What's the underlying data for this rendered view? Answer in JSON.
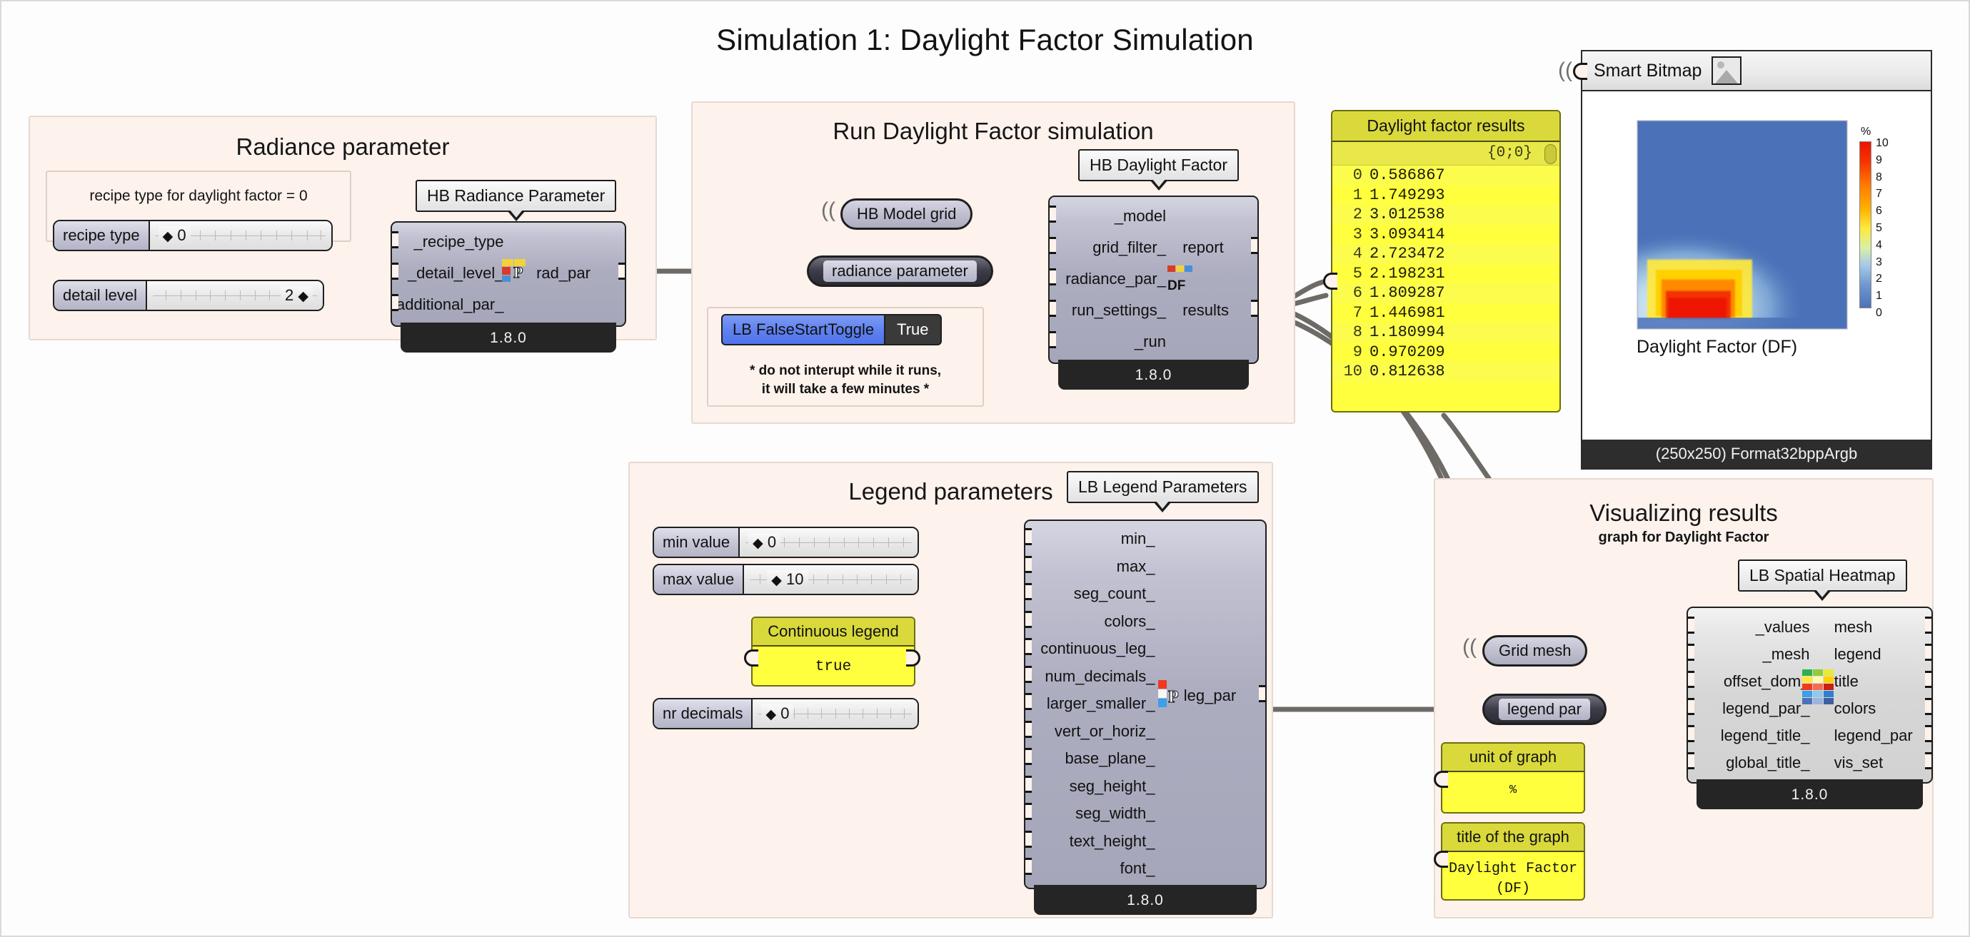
{
  "page": {
    "title": "Simulation 1: Daylight Factor Simulation"
  },
  "groups": {
    "radiance": {
      "title": "Radiance parameter",
      "note": "recipe type for daylight factor = 0",
      "sliders": [
        {
          "name": "recipe type",
          "value": "0",
          "handle": "left"
        },
        {
          "name": "detail level",
          "value": "2",
          "handle": "right"
        }
      ],
      "component": {
        "bubble": "HB Radiance Parameter",
        "inputs": [
          "_recipe_type",
          "_detail_level_",
          "additional_par_"
        ],
        "outputs": [
          "rad_par"
        ],
        "version": "1.8.0"
      }
    },
    "run_sim": {
      "title": "Run Daylight Factor simulation",
      "params": [
        {
          "label": "HB Model grid",
          "style": "light"
        },
        {
          "label": "radiance parameter",
          "style": "dark"
        }
      ],
      "toggle": {
        "name": "LB FalseStartToggle",
        "value": "True"
      },
      "note_line1": "* do not interupt while it runs,",
      "note_line2": "it will take a few minutes *",
      "component": {
        "bubble": "HB Daylight Factor",
        "inputs": [
          "_model",
          "grid_filter_",
          "radiance_par_",
          "run_settings_",
          "_run"
        ],
        "outputs": [
          "report",
          "results"
        ],
        "version": "1.8.0"
      }
    },
    "legend": {
      "title": "Legend parameters",
      "sliders": [
        {
          "name": "min value",
          "value": "0",
          "handle": "left"
        },
        {
          "name": "max value",
          "value": "10",
          "handle": "left"
        },
        {
          "name": "nr decimals",
          "value": "0",
          "handle": "left"
        }
      ],
      "panel": {
        "head": "Continuous legend",
        "body": "true"
      },
      "component": {
        "bubble": "LB Legend Parameters",
        "inputs": [
          "min_",
          "max_",
          "seg_count_",
          "colors_",
          "continuous_leg_",
          "num_decimals_",
          "larger_smaller_",
          "vert_or_horiz_",
          "base_plane_",
          "seg_height_",
          "seg_width_",
          "text_height_",
          "font_"
        ],
        "outputs": [
          "leg_par"
        ],
        "version": "1.8.0"
      }
    },
    "visualizing": {
      "title": "Visualizing results",
      "subtitle": "graph for Daylight Factor",
      "params": [
        {
          "label": "Grid mesh",
          "style": "light"
        },
        {
          "label": "legend par",
          "style": "dark"
        }
      ],
      "panels": [
        {
          "head": "unit of graph",
          "body": "%"
        },
        {
          "head": "title of the graph",
          "body": "Daylight Factor\n(DF)"
        }
      ],
      "component": {
        "bubble": "LB Spatial Heatmap",
        "inputs": [
          "_values",
          "_mesh",
          "offset_dom_",
          "legend_par_",
          "legend_title_",
          "global_title_"
        ],
        "outputs": [
          "mesh",
          "legend",
          "title",
          "colors",
          "legend_par",
          "vis_set"
        ],
        "version": "1.8.0"
      }
    }
  },
  "results_panel": {
    "title": "Daylight factor results",
    "path": "{0;0}",
    "rows": [
      {
        "index": "0",
        "value": "0.586867"
      },
      {
        "index": "1",
        "value": "1.749293"
      },
      {
        "index": "2",
        "value": "3.012538"
      },
      {
        "index": "3",
        "value": "3.093414"
      },
      {
        "index": "4",
        "value": "2.723472"
      },
      {
        "index": "5",
        "value": "2.198231"
      },
      {
        "index": "6",
        "value": "1.809287"
      },
      {
        "index": "7",
        "value": "1.446981"
      },
      {
        "index": "8",
        "value": "1.180994"
      },
      {
        "index": "9",
        "value": "0.970209"
      },
      {
        "index": "10",
        "value": "0.812638"
      }
    ]
  },
  "bitmap": {
    "title": "Smart Bitmap",
    "caption": "Daylight Factor (DF)",
    "footer": "(250x250) Format32bppArgb",
    "legend_unit": "%",
    "legend_ticks": [
      "10",
      "9",
      "8",
      "7",
      "6",
      "5",
      "4",
      "3",
      "2",
      "1",
      "0"
    ]
  },
  "chart_data": {
    "type": "heatmap",
    "title": "Daylight Factor (DF)",
    "unit": "%",
    "legend_min": 0,
    "legend_max": 10,
    "legend_ticks": [
      0,
      1,
      2,
      3,
      4,
      5,
      6,
      7,
      8,
      9,
      10
    ],
    "colors": [
      "#4b72b8",
      "#6f9fd4",
      "#a8cbe8",
      "#d8ecf6",
      "#ffff4d",
      "#ffc400",
      "#ff8000",
      "#f23c00",
      "#e81a00"
    ],
    "description": "Spatial daylight factor grid, 250x250 px. Mostly low (~0-1%) blue field across the plan; a localized hot zone near the lower-left reaching ~10% adjacent to the glazed opening, surrounded by an orange/yellow transition band and a pale-blue gradient fading upward.",
    "hotspot": {
      "x_frac": 0.22,
      "y_frac": 0.88,
      "peak_value": 10
    }
  },
  "theme": {
    "group_bg": "#fdf2ec",
    "node_fill": "#adadc0",
    "node_fill_gray": "#d6d6d6",
    "panel_yellow": "#ffff3e",
    "panel_yellow_head": "#d9d93c",
    "toggle_blue": "#5d80ef",
    "wire_gray": "#6e6a66"
  }
}
